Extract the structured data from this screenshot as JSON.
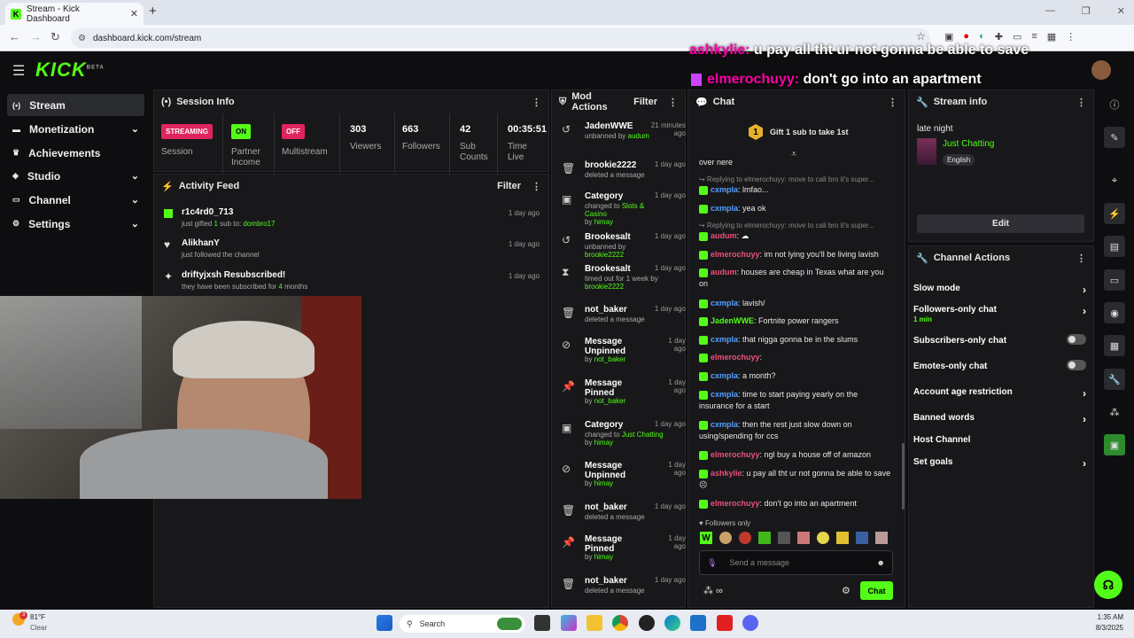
{
  "browser": {
    "tab_title": "Stream - Kick Dashboard",
    "tab_icon": "K",
    "url": "dashboard.kick.com/stream"
  },
  "overlay": {
    "line1_user": "ashkylie:",
    "line1_text": " u pay all tht ur not gonna be able to save",
    "line2_user": "elmerochuyy:",
    "line2_text": " don't go into an apartment"
  },
  "brand": {
    "logo": "KICK",
    "beta": "BETA",
    "accent": "#53fc18"
  },
  "sidebar": {
    "items": [
      {
        "label": "Stream",
        "icon": "(•)"
      },
      {
        "label": "Monetization",
        "icon": "▬"
      },
      {
        "label": "Achievements",
        "icon": "♛"
      },
      {
        "label": "Studio",
        "icon": "◈"
      },
      {
        "label": "Channel",
        "icon": "▭"
      },
      {
        "label": "Settings",
        "icon": "⚙"
      }
    ]
  },
  "session": {
    "title": "Session Info",
    "cells": [
      {
        "badge": "STREAMING",
        "label": "Session"
      },
      {
        "badge": "ON",
        "label": "Partner Income"
      },
      {
        "badge": "OFF",
        "label": "Multistream"
      },
      {
        "value": "303",
        "label": "Viewers"
      },
      {
        "value": "663",
        "label": "Followers"
      },
      {
        "value": "42",
        "label": "Sub Counts"
      },
      {
        "value": "00:35:51",
        "label": "Time Live"
      }
    ]
  },
  "activity": {
    "title": "Activity Feed",
    "filter": "Filter",
    "items": [
      {
        "title": "r1c4rd0_713",
        "sub_a": "just gifted ",
        "sub_b": "1",
        "sub_c": " sub to: ",
        "sub_d": "dombro17",
        "time": "1 day ago"
      },
      {
        "title": "AlikhanY",
        "sub_a": "just followed the channel",
        "time": "1 day ago"
      },
      {
        "title": "driftyjxsh Resubscribed!",
        "sub_a": "they have been subscribed for ",
        "sub_b": "4",
        "sub_c": " months",
        "time": "1 day ago"
      }
    ]
  },
  "mod": {
    "title": "Mod Actions",
    "filter": "Filter",
    "items": [
      {
        "icon": "↺",
        "title": "JadenWWE",
        "sub": "unbanned by",
        "user": "audum",
        "time": "21 minutes ago"
      },
      {
        "icon": "🗑",
        "title": "brookie2222",
        "sub": "deleted a message",
        "user": "",
        "time": "1 day ago"
      },
      {
        "icon": "▣",
        "title": "Category",
        "sub": "changed to",
        "user2": "Slots & Casino",
        "sub2": "by",
        "user": "himay",
        "time": "1 day ago"
      },
      {
        "icon": "↺",
        "title": "Brookesalt",
        "sub": "unbanned by",
        "user": "brookie2222",
        "time": "1 day ago"
      },
      {
        "icon": "⧗",
        "title": "Brookesalt",
        "sub": "timed out for 1 week by",
        "user": "brookie2222",
        "time": "1 day ago"
      },
      {
        "icon": "🗑",
        "title": "not_baker",
        "sub": "deleted a message",
        "user": "",
        "time": "1 day ago"
      },
      {
        "icon": "⊘",
        "title": "Message Unpinned",
        "sub": "by",
        "user": "not_baker",
        "time": "1 day ago"
      },
      {
        "icon": "📌",
        "title": "Message Pinned",
        "sub": "by",
        "user": "not_baker",
        "time": "1 day ago"
      },
      {
        "icon": "▣",
        "title": "Category",
        "sub": "changed to",
        "user2": "Just Chatting",
        "sub2": "by",
        "user": "himay",
        "time": "1 day ago"
      },
      {
        "icon": "⊘",
        "title": "Message Unpinned",
        "sub": "by",
        "user": "himay",
        "time": "1 day ago"
      },
      {
        "icon": "🗑",
        "title": "not_baker",
        "sub": "deleted a message",
        "user": "",
        "time": "1 day ago"
      },
      {
        "icon": "📌",
        "title": "Message Pinned",
        "sub": "by",
        "user": "himay",
        "time": "1 day ago"
      },
      {
        "icon": "🗑",
        "title": "not_baker",
        "sub": "deleted a message",
        "user": "",
        "time": "1 day ago"
      }
    ]
  },
  "chat": {
    "title": "Chat",
    "gift_num": "1",
    "gift_text": "Gift 1 sub to take 1st",
    "lines": [
      {
        "text": "over nere"
      },
      {
        "reply": "↪ Replying to elmerochuyy: move to cali bro it's super..."
      },
      {
        "user": "cxmpla",
        "color": "blu",
        "text": ": lmfao..."
      },
      {
        "user": "cxmpla",
        "color": "blu",
        "text": ": yea ok"
      },
      {
        "reply": "↪ Replying to elmerochuyy: move to cali bro it's super..."
      },
      {
        "user": "audum",
        "color": "pnk",
        "text": ": ☁"
      },
      {
        "user": "elmerochuyy",
        "color": "pnk",
        "text": ": im not lying you'll be living lavish"
      },
      {
        "user": "audum",
        "color": "pnk",
        "text": ": houses are cheap in Texas what are you on"
      },
      {
        "user": "cxmpla",
        "color": "blu",
        "text": ": lavish/"
      },
      {
        "user": "JadenWWE",
        "color": "grn2",
        "text": ": Fortnite power rangers"
      },
      {
        "user": "cxmpla",
        "color": "blu",
        "text": ": that nigga gonna be in the slums"
      },
      {
        "user": "elmerochuyy",
        "color": "pnk",
        "text": ":"
      },
      {
        "user": "cxmpla",
        "color": "blu",
        "text": ": a month?"
      },
      {
        "user": "cxmpla",
        "color": "blu",
        "text": ": time to start paying yearly on the insurance for a start"
      },
      {
        "user": "cxmpla",
        "color": "blu",
        "text": ": then the rest just slow down on using/spending for ccs"
      },
      {
        "user": "elmerochuyy",
        "color": "pnk",
        "text": ": ngl buy a house off of amazon"
      },
      {
        "user": "ashkylie",
        "color": "pnk",
        "text": ": u pay all tht ur not gonna be able to save ☹"
      },
      {
        "user": "elmerochuyy",
        "color": "pnk",
        "text": ": don't go into an apartment"
      }
    ],
    "followers_only": "Followers only",
    "placeholder": "Send a message",
    "send": "Chat"
  },
  "stream_info": {
    "title": "Stream info",
    "stream_title": "late night",
    "category": "Just Chatting",
    "language": "English",
    "edit": "Edit"
  },
  "channel_actions": {
    "title": "Channel Actions",
    "items": [
      {
        "label": "Slow mode",
        "kind": "chev"
      },
      {
        "label": "Followers-only chat",
        "sub": "1 min",
        "kind": "chev"
      },
      {
        "label": "Subscribers-only chat",
        "kind": "toggle"
      },
      {
        "label": "Emotes-only chat",
        "kind": "toggle"
      },
      {
        "label": "Account age restriction",
        "kind": "chev"
      },
      {
        "label": "Banned words",
        "kind": "chev"
      },
      {
        "label": "Host Channel",
        "kind": "none"
      },
      {
        "label": "Set goals",
        "kind": "chev"
      }
    ]
  },
  "taskbar": {
    "temp": "81°F",
    "weather": "Clear",
    "weather_badge": "3",
    "search": "Search",
    "time": "1:35 AM",
    "date": "8/3/2025"
  }
}
